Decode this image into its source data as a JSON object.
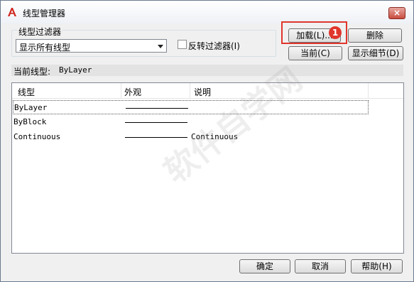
{
  "window": {
    "title": "线型管理器",
    "close_label": "×"
  },
  "filter": {
    "group_label": "线型过滤器",
    "selected": "显示所有线型",
    "invert_label": "反转过滤器(I)",
    "invert_checked": false
  },
  "buttons": {
    "load": "加载(L)...",
    "delete": "删除",
    "current": "当前(C)",
    "show_details": "显示细节(D)",
    "ok": "确定",
    "cancel": "取消",
    "help": "帮助(H)"
  },
  "annotation": {
    "badge": "1",
    "color": "#e0362c"
  },
  "current_linetype": {
    "label": "当前线型:",
    "value": "ByLayer"
  },
  "table": {
    "columns": [
      "线型",
      "外观",
      "说明"
    ],
    "rows": [
      {
        "name": "ByLayer",
        "description": "",
        "selected": true
      },
      {
        "name": "ByBlock",
        "description": "",
        "selected": false
      },
      {
        "name": "Continuous",
        "description": "Continuous",
        "selected": false
      }
    ]
  },
  "watermark": "软件自学网"
}
